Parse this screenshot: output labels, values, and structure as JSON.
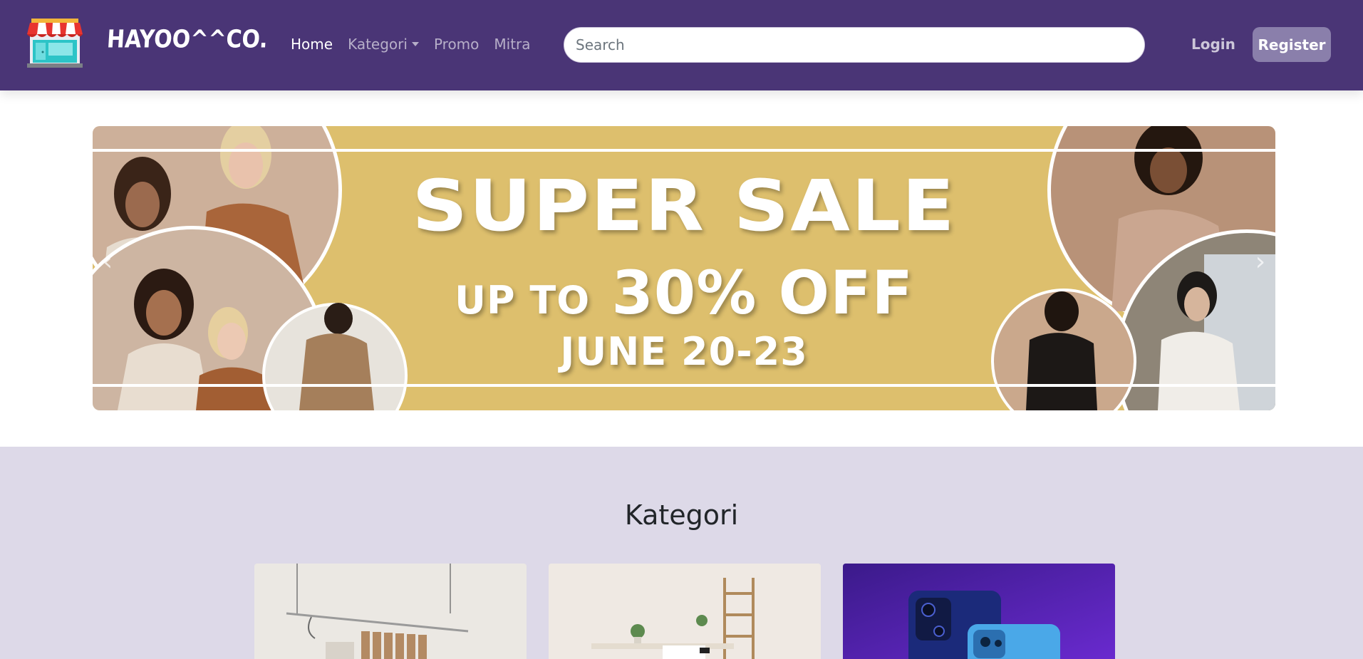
{
  "navbar": {
    "brand": "HAYOO^^CO.",
    "logo_icon": "storefront-icon",
    "links": [
      {
        "label": "Home",
        "active": true
      },
      {
        "label": "Kategori",
        "dropdown": true
      },
      {
        "label": "Promo"
      },
      {
        "label": "Mitra"
      }
    ],
    "search": {
      "placeholder": "Search",
      "value": ""
    },
    "login_label": "Login",
    "register_label": "Register"
  },
  "carousel": {
    "headline": "SUPER SALE",
    "subline_prefix": "UP TO",
    "subline_main": "30% OFF",
    "dates": "JUNE 20-23",
    "prev_icon": "chevron-left-icon",
    "next_icon": "chevron-right-icon",
    "prev_glyph": "‹",
    "next_glyph": "›"
  },
  "kategori": {
    "title": "Kategori",
    "cards": [
      {
        "name": "clothing-rack-image"
      },
      {
        "name": "home-living-image"
      },
      {
        "name": "smartphones-image"
      }
    ]
  },
  "colors": {
    "navbar": "#4a3576",
    "register_button": "#8a7fab",
    "banner_gold": "#ddbf6d",
    "section_bg": "#ddd9e8"
  }
}
